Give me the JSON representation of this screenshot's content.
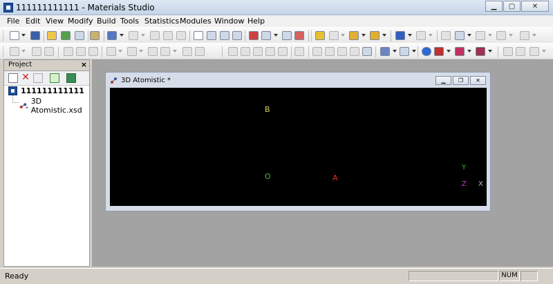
{
  "window": {
    "title": "111111111111 - Materials Studio"
  },
  "menu": [
    "File",
    "Edit",
    "View",
    "Modify",
    "Build",
    "Tools",
    "Statistics",
    "Modules",
    "Window",
    "Help"
  ],
  "project": {
    "title": "Project",
    "close": "×",
    "root_label": "111111111111",
    "child_label": "3D Atomistic.xsd"
  },
  "document": {
    "title": "3D Atomistic *",
    "labels": {
      "b": "B",
      "o": "O",
      "a": "A",
      "y": "Y",
      "z": "Z",
      "x": "X"
    }
  },
  "colors": {
    "b": "#d6d65a",
    "o": "#3fbf3f",
    "a": "#e03030",
    "y": "#22cc22",
    "z": "#cc33cc",
    "x": "#bbbbbb"
  },
  "status": {
    "text": "Ready",
    "num": "NUM"
  }
}
